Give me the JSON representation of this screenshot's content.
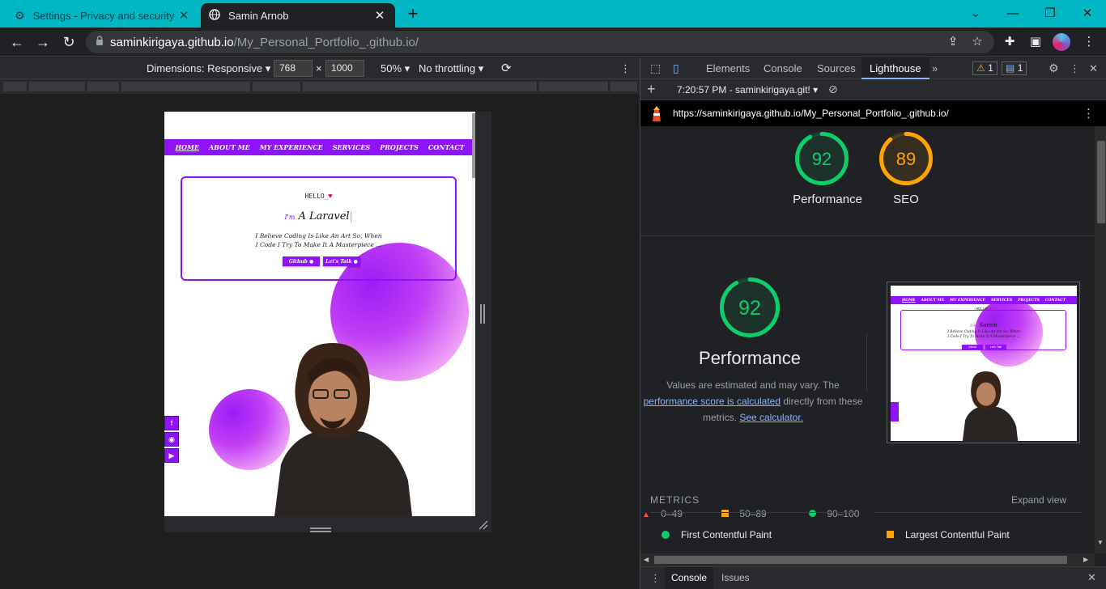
{
  "browser": {
    "tabs": [
      {
        "label": "Settings - Privacy and security",
        "icon": "gear-icon"
      },
      {
        "label": "Samin Arnob",
        "icon": "globe-icon"
      }
    ],
    "url_host": "saminkirigaya.github.io",
    "url_path": "/My_Personal_Portfolio_.github.io/"
  },
  "device_toolbar": {
    "dimensions": "Dimensions: Responsive",
    "width": "768",
    "height": "1000",
    "times": "×",
    "zoom": "50%",
    "throttling": "No throttling"
  },
  "site": {
    "nav": [
      "HOME",
      "ABOUT ME",
      "MY EXPERIENCE",
      "SERVICES",
      "PROJECTS",
      "CONTACT"
    ],
    "hello": "HELLO",
    "im": "I'm",
    "typed": "A Laravel",
    "tagline_1": "I Believe Coding Is Like An Art So, When",
    "tagline_2": "I Code I Try To Make It A Masterpiece ...",
    "btn_github": "Github",
    "btn_talk": "Let's Talk"
  },
  "devtools": {
    "tabs": [
      "Elements",
      "Console",
      "Sources",
      "Lighthouse"
    ],
    "warnings": "1",
    "messages": "1",
    "report_time": "7:20:57 PM - saminkirigaya.git!",
    "report_url": "https://saminkirigaya.github.io/My_Personal_Portfolio_.github.io/",
    "scores": [
      {
        "label": "Performance",
        "value": 92,
        "color": "#0cce6b"
      },
      {
        "label": "SEO",
        "value": 89,
        "color": "#ffa400"
      }
    ],
    "perf_title": "Performance",
    "perf_desc_1": "Values are estimated and may vary. The",
    "perf_link": "performance score is calculated",
    "perf_desc_2": " directly from these",
    "perf_desc_3": "metrics. ",
    "calc_link": "See calculator.",
    "legend": [
      "0–49",
      "50–89",
      "90–100"
    ],
    "metrics_title": "METRICS",
    "expand": "Expand view",
    "metric_1": "First Contentful Paint",
    "metric_2": "Largest Contentful Paint",
    "drawer_tabs": [
      "Console",
      "Issues"
    ],
    "thumb_nav": [
      "HOME",
      "ABOUT ME",
      "MY EXPERIENCE",
      "SERVICES",
      "PROJECTS",
      "CONTACT"
    ],
    "thumb_hello": "HELLO",
    "thumb_im": "I'm",
    "thumb_name": "Samin",
    "thumb_tag_1": "I Believe Coding Is Like An Art So, When",
    "thumb_tag_2": "I Code I Try To Make It A Masterpiece ...",
    "thumb_btn_1": "Github",
    "thumb_btn_2": "Let's Talk"
  },
  "colors": {
    "tab_strip": "#00b7c3",
    "site_accent": "#8e13f9",
    "good": "#0cce6b",
    "average": "#ffa400",
    "fail": "#ff4e42"
  }
}
